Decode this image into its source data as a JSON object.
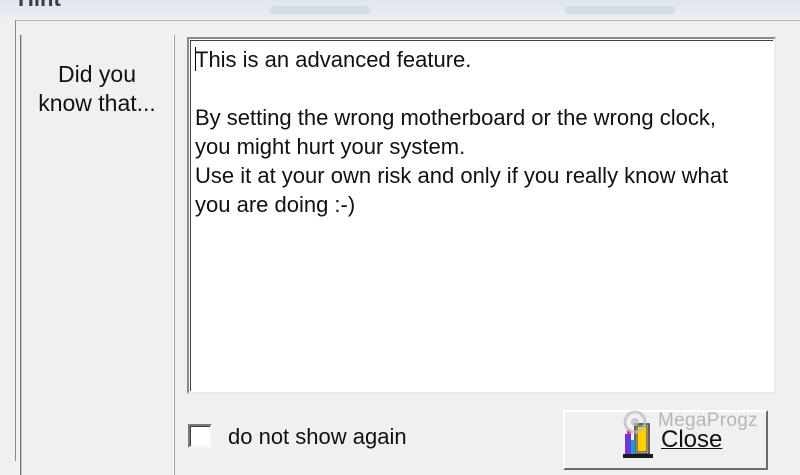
{
  "window": {
    "title": "Hint"
  },
  "sidebar": {
    "heading": "Did you know that..."
  },
  "memo": {
    "text": "This is an advanced feature.\n\nBy setting the wrong motherboard or the wrong clock,\nyou might hurt your system.\nUse it at your own risk and only if you really know what\nyou are doing :-)"
  },
  "footer": {
    "checkbox_label": "do not show again",
    "checkbox_checked": false,
    "close_label": "Close"
  },
  "watermark": {
    "text": "MegaProgz"
  },
  "icons": {
    "close": "door-exit-icon",
    "watermark_logo": "megaprogz-logo"
  }
}
